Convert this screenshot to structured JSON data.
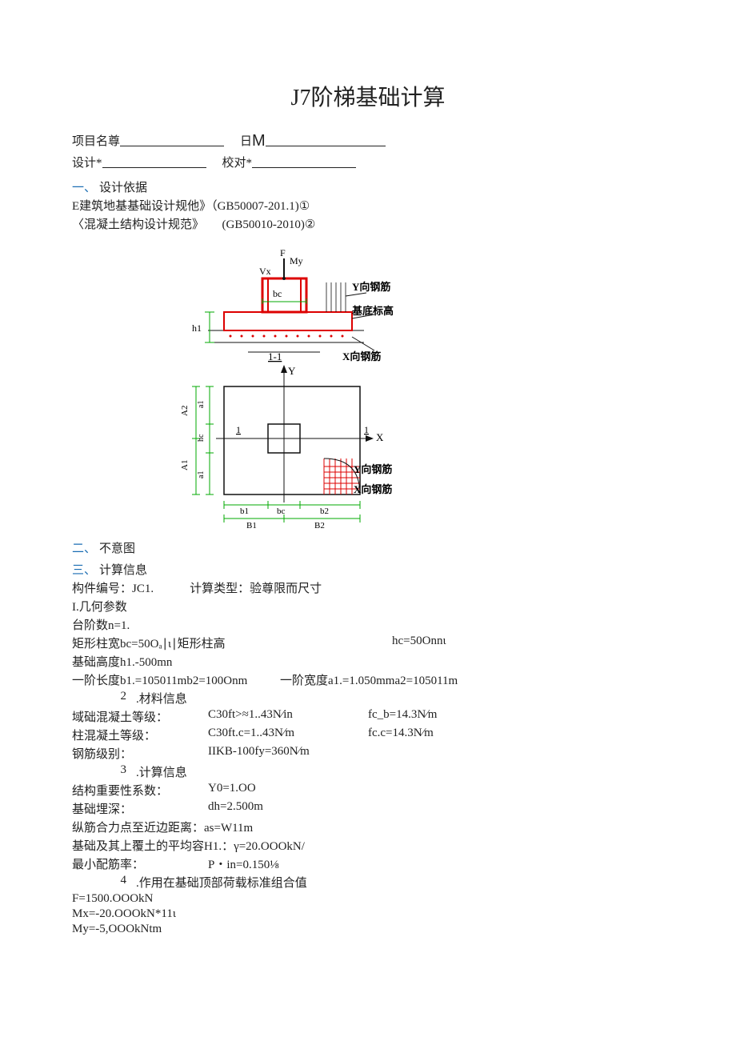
{
  "title": "J7阶梯基础计算",
  "header": {
    "project_label": "项目名尊",
    "date_label_prefix": "日",
    "date_big": "M",
    "designer_label": "设计*",
    "reviewer_label": "校对*"
  },
  "sec1": {
    "num": "一、",
    "title": "设计依据",
    "refs": [
      "E建筑地基基础设计规他》（GB50007-201.1)①",
      "〈混凝土结构设计规范》　　(GB50010-2010)②"
    ]
  },
  "diagram": {
    "labels": {
      "F": "F",
      "My": "My",
      "Vx": "Vx",
      "bc_top": "bc",
      "Yrebar": "Y向钢筋",
      "baselevel": "基底标高",
      "sec11": "1-1",
      "Xrebar_top": "X向钢筋",
      "h1": "h1",
      "Y": "Y",
      "X": "X",
      "one_l": "1",
      "one_r": "1",
      "A2": "A2",
      "A1": "A1",
      "a1_l": "a1",
      "a1_l2": "a1",
      "hc": "hc",
      "b1": "b1",
      "bc": "bc",
      "b2": "b2",
      "B1": "B1",
      "B2": "B2",
      "Yrebar2": "Y向钢筋",
      "Xrebar2": "X向钢筋"
    }
  },
  "sec2": {
    "num": "二、",
    "title": "不意图"
  },
  "sec3": {
    "num": "三、",
    "title": "计算信息",
    "member_line": "构件编号：JC1.　　　计算类型：验尊限而尺寸",
    "g1": {
      "h": "I.几何参数",
      "steps": "台阶数n=1.",
      "rect_line": "矩形柱宽bc=50Oₐ∣ι∣矩形柱高",
      "hc": "hc=50Onnι",
      "base_h": "基础高度h1.-500mn",
      "span_a": "一阶长度b1.=105011mb2=100Onm",
      "span_b": "一阶宽度a1.=1.050mma2=105011m"
    },
    "g2": {
      "num": "2",
      "h": ".材料信息",
      "r1": {
        "a": "域础混凝土等级：",
        "b": "C30ft>≈1..43N∕in",
        "c": "fc_b=14.3N∕m"
      },
      "r2": {
        "a": "柱混凝土等级：",
        "b": "C30ft.c=1..43N∕m",
        "c": "fc.c=14.3N∕m"
      },
      "r3": {
        "a": "钢筋级别：",
        "b": "IIKB-100fy=360N∕m",
        "c": ""
      }
    },
    "g3": {
      "num": "3",
      "h": ".计算信息",
      "r1": {
        "a": "结构重要性系数：",
        "b": "Y0=1.OO"
      },
      "r2": {
        "a": "基础埋深：",
        "b": "dh=2.500m"
      },
      "r3": "纵筋合力点至近边距离：as=W11m",
      "r4": "基础及其上覆土的平均容H1.：γ=20.OOOkN/",
      "r5": {
        "a": "最小配筋率：",
        "b": "P・in=0.150⅛"
      }
    },
    "g4": {
      "num": "4",
      "h": ".作用在基础顶部荷载标准组合值",
      "r1": "F=1500.OOOkN",
      "r2": "Mx=-20.OOOkN*11ι",
      "r3": "My=-5,OOOkNtm"
    }
  }
}
